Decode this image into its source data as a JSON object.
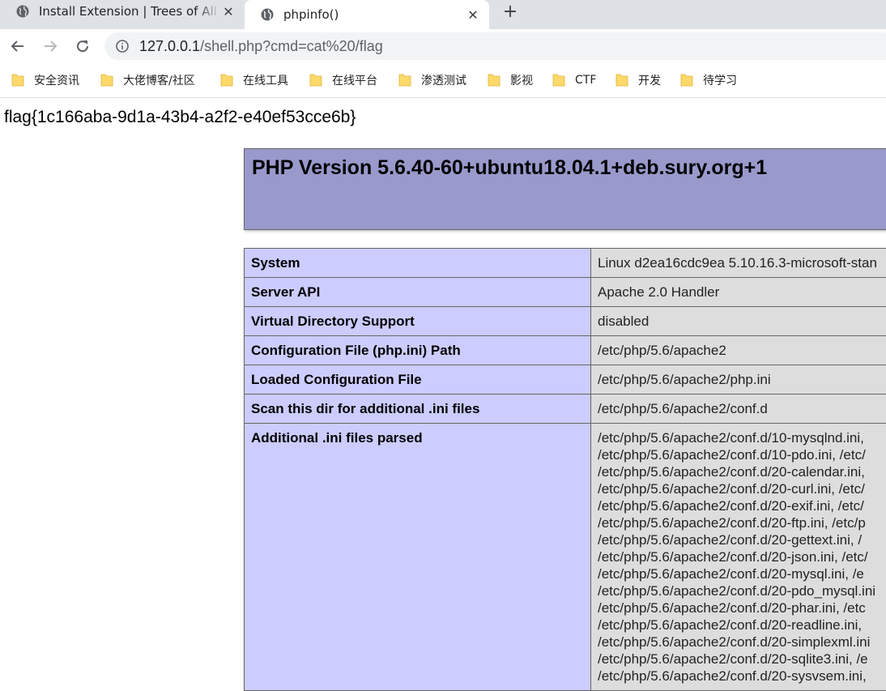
{
  "tabs": [
    {
      "title": "Install Extension | Trees of All S",
      "icon": "globe-icon",
      "close": "✕"
    },
    {
      "title": "phpinfo()",
      "icon": "globe-icon",
      "close": "✕"
    }
  ],
  "new_tab": "+",
  "address": {
    "host": "127.0.0.1",
    "path": "/shell.php?cmd=cat%20/flag"
  },
  "bookmarks": [
    "安全资讯",
    "大佬博客/社区",
    "在线工具",
    "在线平台",
    "渗透测试",
    "影视",
    "CTF",
    "开发",
    "待学习"
  ],
  "page": {
    "flag_text": "flag{1c166aba-9d1a-43b4-a2f2-e40ef53cce6b}",
    "php_version": "PHP Version 5.6.40-60+ubuntu18.04.1+deb.sury.org+1",
    "rows": [
      {
        "key": "System",
        "value": "Linux d2ea16cdc9ea 5.10.16.3-microsoft-stan"
      },
      {
        "key": "Server API",
        "value": "Apache 2.0 Handler"
      },
      {
        "key": "Virtual Directory Support",
        "value": "disabled"
      },
      {
        "key": "Configuration File (php.ini) Path",
        "value": "/etc/php/5.6/apache2"
      },
      {
        "key": "Loaded Configuration File",
        "value": "/etc/php/5.6/apache2/php.ini"
      },
      {
        "key": "Scan this dir for additional .ini files",
        "value": "/etc/php/5.6/apache2/conf.d"
      }
    ],
    "additional_key": "Additional .ini files parsed",
    "additional_lines": [
      "/etc/php/5.6/apache2/conf.d/10-mysqlnd.ini,",
      "/etc/php/5.6/apache2/conf.d/10-pdo.ini, /etc/",
      "/etc/php/5.6/apache2/conf.d/20-calendar.ini,",
      "/etc/php/5.6/apache2/conf.d/20-curl.ini, /etc/",
      "/etc/php/5.6/apache2/conf.d/20-exif.ini, /etc/",
      "/etc/php/5.6/apache2/conf.d/20-ftp.ini, /etc/p",
      "/etc/php/5.6/apache2/conf.d/20-gettext.ini, /",
      "/etc/php/5.6/apache2/conf.d/20-json.ini, /etc/",
      "/etc/php/5.6/apache2/conf.d/20-mysql.ini, /e",
      "/etc/php/5.6/apache2/conf.d/20-pdo_mysql.ini",
      "/etc/php/5.6/apache2/conf.d/20-phar.ini, /etc",
      "/etc/php/5.6/apache2/conf.d/20-readline.ini, ",
      "/etc/php/5.6/apache2/conf.d/20-simplexml.ini",
      "/etc/php/5.6/apache2/conf.d/20-sqlite3.ini, /e",
      "/etc/php/5.6/apache2/conf.d/20-sysvsem.ini,"
    ]
  },
  "colors": {
    "header_bg": "#9999cc",
    "key_bg": "#ccccff",
    "value_bg": "#dddddd",
    "tabstrip_bg": "#dee1e6",
    "folder": "#fcd96a"
  }
}
